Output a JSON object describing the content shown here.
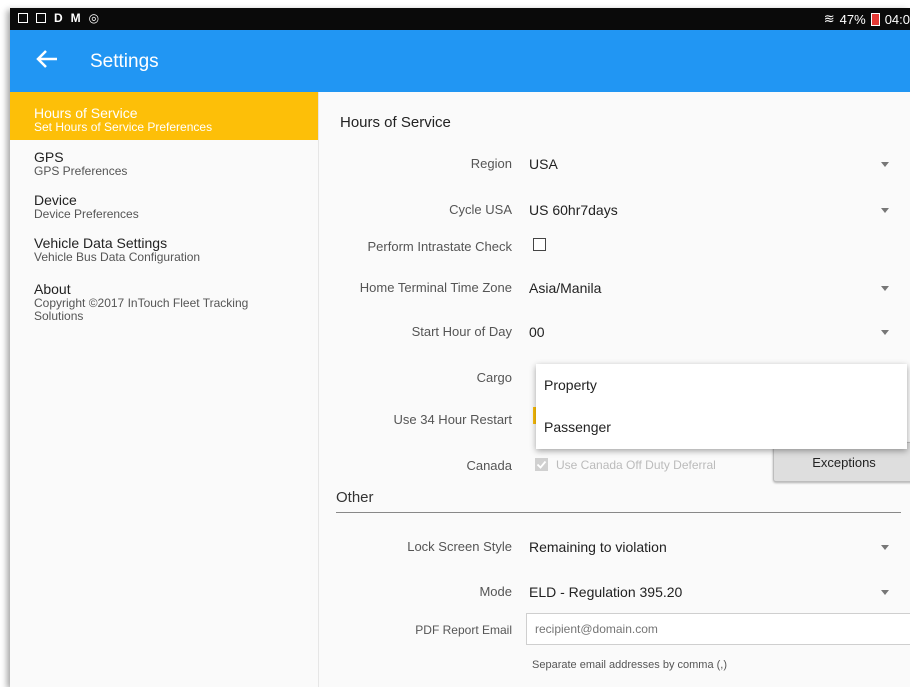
{
  "status_bar": {
    "left_icons": [
      "D",
      "M"
    ],
    "battery": "47%",
    "time": "04:0"
  },
  "app_bar": {
    "title": "Settings"
  },
  "sidebar": {
    "items": [
      {
        "label": "Hours of Service",
        "sub": "Set Hours of Service Preferences",
        "active": true
      },
      {
        "label": "GPS",
        "sub": "GPS Preferences"
      },
      {
        "label": "Device",
        "sub": "Device Preferences"
      },
      {
        "label": "Vehicle Data Settings",
        "sub": "Vehicle Bus Data Configuration"
      },
      {
        "label": "About",
        "sub": "Copyright ©2017 InTouch Fleet Tracking Solutions"
      }
    ]
  },
  "hos": {
    "section_title": "Hours of Service",
    "region_label": "Region",
    "region_value": "USA",
    "cycle_label": "Cycle USA",
    "cycle_value": "US 60hr7days",
    "intrastate_label": "Perform Intrastate Check",
    "timezone_label": "Home Terminal Time Zone",
    "timezone_value": "Asia/Manila",
    "start_hour_label": "Start Hour of Day",
    "start_hour_value": "00",
    "cargo_label": "Cargo",
    "cargo_options": [
      "Property",
      "Passenger"
    ],
    "restart_label": "Use 34 Hour Restart",
    "canada_label": "Canada",
    "canada_deferral_label": "Use Canada Off Duty Deferral",
    "exceptions_label": "Exceptions"
  },
  "other": {
    "section_title": "Other",
    "lock_label": "Lock Screen Style",
    "lock_value": "Remaining to violation",
    "mode_label": "Mode",
    "mode_value": "ELD - Regulation 395.20",
    "pdf_label": "PDF Report Email",
    "pdf_placeholder": "recipient@domain.com",
    "pdf_hint": "Separate email addresses by comma (,)"
  },
  "colors": {
    "app_bar": "#2196f3",
    "active_item": "#fdbf08",
    "accent": "#fdbf08"
  }
}
